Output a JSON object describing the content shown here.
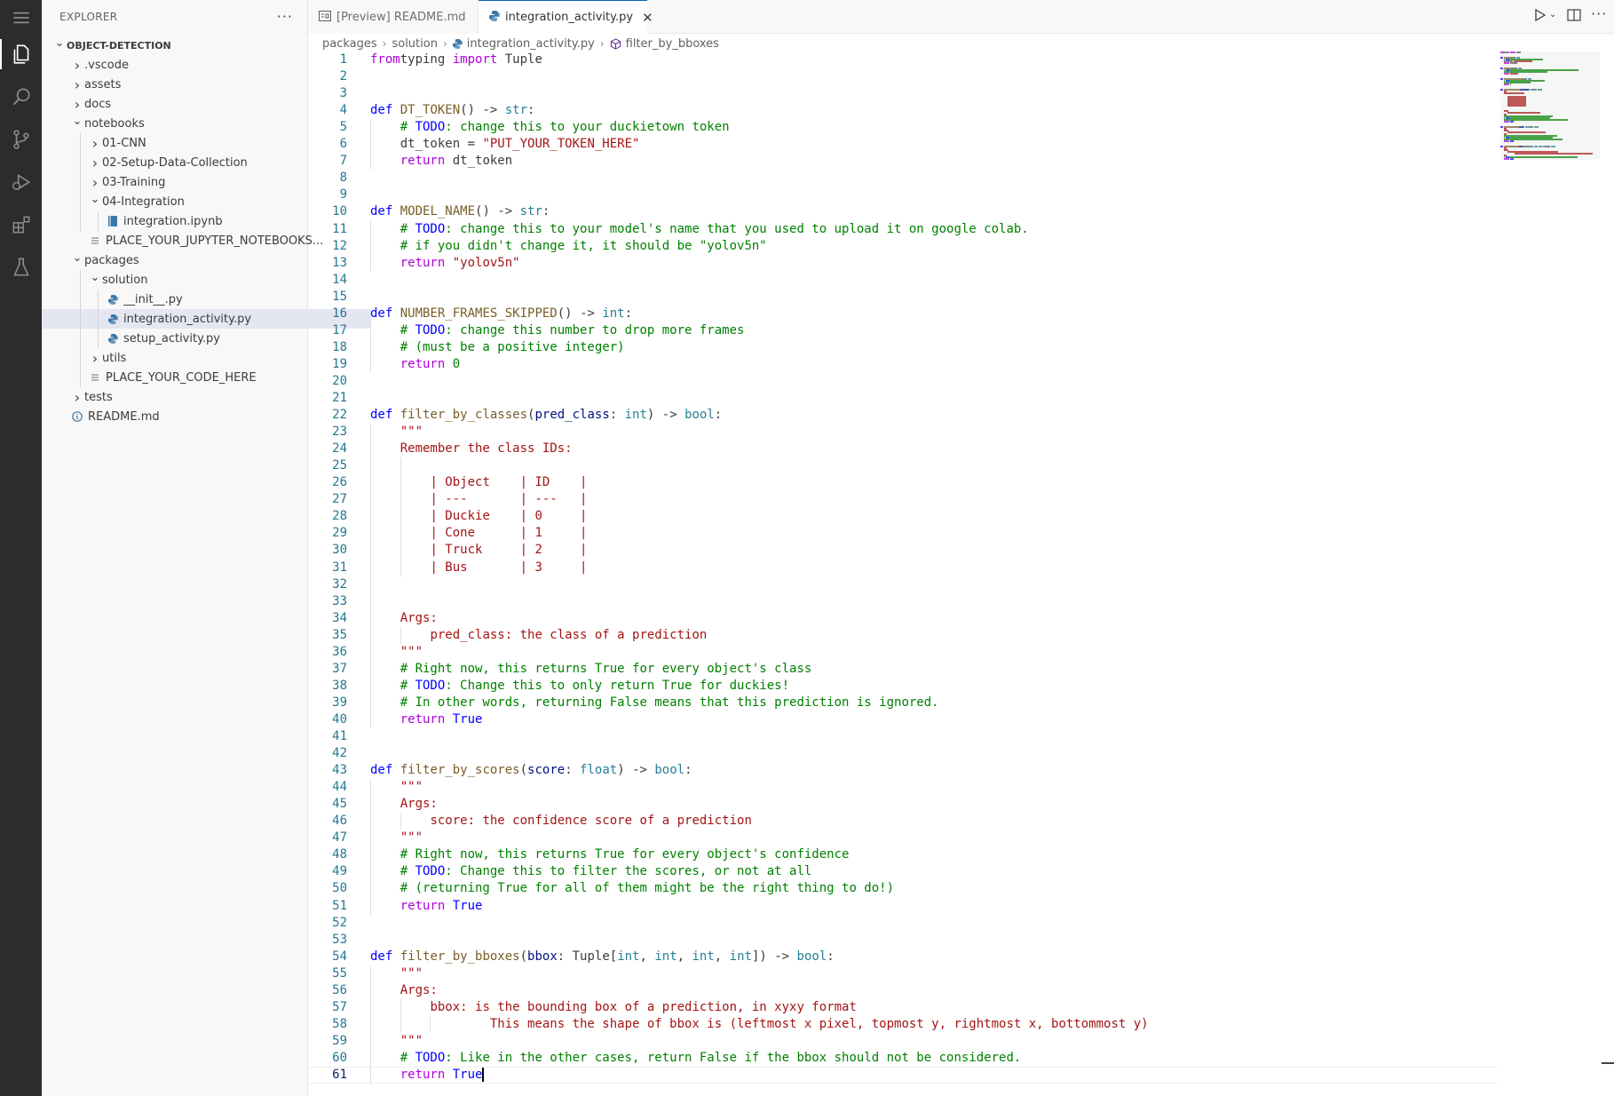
{
  "sidebar": {
    "title": "EXPLORER",
    "more_label": "···",
    "tree": [
      {
        "label": "OBJECT-DETECTION",
        "depth": 0,
        "kind": "root",
        "open": true
      },
      {
        "label": ".vscode",
        "depth": 1,
        "kind": "folder",
        "open": false
      },
      {
        "label": "assets",
        "depth": 1,
        "kind": "folder",
        "open": false
      },
      {
        "label": "docs",
        "depth": 1,
        "kind": "folder",
        "open": false
      },
      {
        "label": "notebooks",
        "depth": 1,
        "kind": "folder",
        "open": true
      },
      {
        "label": "01-CNN",
        "depth": 2,
        "kind": "folder",
        "open": false
      },
      {
        "label": "02-Setup-Data-Collection",
        "depth": 2,
        "kind": "folder",
        "open": false
      },
      {
        "label": "03-Training",
        "depth": 2,
        "kind": "folder",
        "open": false
      },
      {
        "label": "04-Integration",
        "depth": 2,
        "kind": "folder",
        "open": true
      },
      {
        "label": "integration.ipynb",
        "depth": 3,
        "kind": "notebook"
      },
      {
        "label": "PLACE_YOUR_JUPYTER_NOTEBOOKS...",
        "depth": 2,
        "kind": "file"
      },
      {
        "label": "packages",
        "depth": 1,
        "kind": "folder",
        "open": true
      },
      {
        "label": "solution",
        "depth": 2,
        "kind": "folder",
        "open": true
      },
      {
        "label": "__init__.py",
        "depth": 3,
        "kind": "python"
      },
      {
        "label": "integration_activity.py",
        "depth": 3,
        "kind": "python",
        "selected": true
      },
      {
        "label": "setup_activity.py",
        "depth": 3,
        "kind": "python"
      },
      {
        "label": "utils",
        "depth": 2,
        "kind": "folder",
        "open": false
      },
      {
        "label": "PLACE_YOUR_CODE_HERE",
        "depth": 2,
        "kind": "file"
      },
      {
        "label": "tests",
        "depth": 1,
        "kind": "folder",
        "open": false
      },
      {
        "label": "README.md",
        "depth": 1,
        "kind": "info"
      }
    ]
  },
  "tabs": [
    {
      "label": "[Preview] README.md",
      "active": false,
      "icon": "preview-icon"
    },
    {
      "label": "integration_activity.py",
      "active": true,
      "icon": "python-icon"
    }
  ],
  "breadcrumb": [
    "packages",
    "solution",
    "integration_activity.py",
    "filter_by_bboxes"
  ],
  "editor": {
    "current_line": 61,
    "lines": [
      [
        [
          "kc",
          "from"
        ],
        [
          "",
          "typing "
        ],
        [
          "kc",
          "import"
        ],
        [
          "",
          " Tuple"
        ]
      ],
      [],
      [],
      [
        [
          "kw",
          "def"
        ],
        [
          "",
          " "
        ],
        [
          "fn",
          "DT_TOKEN"
        ],
        [
          "",
          "() -> "
        ],
        [
          "ty",
          "str"
        ],
        [
          "",
          ":"
        ]
      ],
      [
        [
          "",
          "    "
        ],
        [
          "cm",
          "# "
        ],
        [
          "td",
          "TODO"
        ],
        [
          "cm",
          ": change this to your duckietown token"
        ]
      ],
      [
        [
          "",
          "    dt_token = "
        ],
        [
          "st",
          "\"PUT_YOUR_TOKEN_HERE\""
        ]
      ],
      [
        [
          "",
          "    "
        ],
        [
          "kc",
          "return"
        ],
        [
          "",
          " dt_token"
        ]
      ],
      [],
      [],
      [
        [
          "kw",
          "def"
        ],
        [
          "",
          " "
        ],
        [
          "fn",
          "MODEL_NAME"
        ],
        [
          "",
          "() -> "
        ],
        [
          "ty",
          "str"
        ],
        [
          "",
          ":"
        ]
      ],
      [
        [
          "",
          "    "
        ],
        [
          "cm",
          "# "
        ],
        [
          "td",
          "TODO"
        ],
        [
          "cm",
          ": change this to your model's name that you used to upload it on google colab."
        ]
      ],
      [
        [
          "",
          "    "
        ],
        [
          "cm",
          "# if you didn't change it, it should be \"yolov5n\""
        ]
      ],
      [
        [
          "",
          "    "
        ],
        [
          "kc",
          "return"
        ],
        [
          "",
          " "
        ],
        [
          "st",
          "\"yolov5n\""
        ]
      ],
      [],
      [],
      [
        [
          "kw",
          "def"
        ],
        [
          "",
          " "
        ],
        [
          "fn",
          "NUMBER_FRAMES_SKIPPED"
        ],
        [
          "",
          "() -> "
        ],
        [
          "ty",
          "int"
        ],
        [
          "",
          ":"
        ]
      ],
      [
        [
          "",
          "    "
        ],
        [
          "cm",
          "# "
        ],
        [
          "td",
          "TODO"
        ],
        [
          "cm",
          ": change this number to drop more frames"
        ]
      ],
      [
        [
          "",
          "    "
        ],
        [
          "cm",
          "# (must be a positive integer)"
        ]
      ],
      [
        [
          "",
          "    "
        ],
        [
          "kc",
          "return"
        ],
        [
          "",
          " "
        ],
        [
          "cm",
          "0"
        ]
      ],
      [],
      [],
      [
        [
          "kw",
          "def"
        ],
        [
          "",
          " "
        ],
        [
          "fn",
          "filter_by_classes"
        ],
        [
          "",
          "("
        ],
        [
          "pm",
          "pred_class"
        ],
        [
          "",
          ": "
        ],
        [
          "ty",
          "int"
        ],
        [
          "",
          ") -> "
        ],
        [
          "ty",
          "bool"
        ],
        [
          "",
          ":"
        ]
      ],
      [
        [
          "",
          "    "
        ],
        [
          "st",
          "\"\"\""
        ]
      ],
      [
        [
          "",
          "    "
        ],
        [
          "st",
          "Remember the class IDs:"
        ]
      ],
      [],
      [
        [
          "",
          "        "
        ],
        [
          "st",
          "| Object    | ID    |"
        ]
      ],
      [
        [
          "",
          "        "
        ],
        [
          "st",
          "| ---       | ---   |"
        ]
      ],
      [
        [
          "",
          "        "
        ],
        [
          "st",
          "| Duckie    | 0     |"
        ]
      ],
      [
        [
          "",
          "        "
        ],
        [
          "st",
          "| Cone      | 1     |"
        ]
      ],
      [
        [
          "",
          "        "
        ],
        [
          "st",
          "| Truck     | 2     |"
        ]
      ],
      [
        [
          "",
          "        "
        ],
        [
          "st",
          "| Bus       | 3     |"
        ]
      ],
      [],
      [],
      [
        [
          "",
          "    "
        ],
        [
          "st",
          "Args:"
        ]
      ],
      [
        [
          "",
          "        "
        ],
        [
          "st",
          "pred_class: the class of a prediction"
        ]
      ],
      [
        [
          "",
          "    "
        ],
        [
          "st",
          "\"\"\""
        ]
      ],
      [
        [
          "",
          "    "
        ],
        [
          "cm",
          "# Right now, this returns True for every object's class"
        ]
      ],
      [
        [
          "",
          "    "
        ],
        [
          "cm",
          "# "
        ],
        [
          "td",
          "TODO"
        ],
        [
          "cm",
          ": Change this to only return True for duckies!"
        ]
      ],
      [
        [
          "",
          "    "
        ],
        [
          "cm",
          "# In other words, returning False means that this prediction is ignored."
        ]
      ],
      [
        [
          "",
          "    "
        ],
        [
          "kc",
          "return"
        ],
        [
          "",
          " "
        ],
        [
          "kw",
          "True"
        ]
      ],
      [],
      [],
      [
        [
          "kw",
          "def"
        ],
        [
          "",
          " "
        ],
        [
          "fn",
          "filter_by_scores"
        ],
        [
          "",
          "("
        ],
        [
          "pm",
          "score"
        ],
        [
          "",
          ": "
        ],
        [
          "ty",
          "float"
        ],
        [
          "",
          ") -> "
        ],
        [
          "ty",
          "bool"
        ],
        [
          "",
          ":"
        ]
      ],
      [
        [
          "",
          "    "
        ],
        [
          "st",
          "\"\"\""
        ]
      ],
      [
        [
          "",
          "    "
        ],
        [
          "st",
          "Args:"
        ]
      ],
      [
        [
          "",
          "        "
        ],
        [
          "st",
          "score: the confidence score of a prediction"
        ]
      ],
      [
        [
          "",
          "    "
        ],
        [
          "st",
          "\"\"\""
        ]
      ],
      [
        [
          "",
          "    "
        ],
        [
          "cm",
          "# Right now, this returns True for every object's confidence"
        ]
      ],
      [
        [
          "",
          "    "
        ],
        [
          "cm",
          "# "
        ],
        [
          "td",
          "TODO"
        ],
        [
          "cm",
          ": Change this to filter the scores, or not at all"
        ]
      ],
      [
        [
          "",
          "    "
        ],
        [
          "cm",
          "# (returning True for all of them might be the right thing to do!)"
        ]
      ],
      [
        [
          "",
          "    "
        ],
        [
          "kc",
          "return"
        ],
        [
          "",
          " "
        ],
        [
          "kw",
          "True"
        ]
      ],
      [],
      [],
      [
        [
          "kw",
          "def"
        ],
        [
          "",
          " "
        ],
        [
          "fn",
          "filter_by_bboxes"
        ],
        [
          "",
          "("
        ],
        [
          "pm",
          "bbox"
        ],
        [
          "",
          ": Tuple["
        ],
        [
          "ty",
          "int"
        ],
        [
          "",
          ", "
        ],
        [
          "ty",
          "int"
        ],
        [
          "",
          ", "
        ],
        [
          "ty",
          "int"
        ],
        [
          "",
          ", "
        ],
        [
          "ty",
          "int"
        ],
        [
          "",
          "]) -> "
        ],
        [
          "ty",
          "bool"
        ],
        [
          "",
          ":"
        ]
      ],
      [
        [
          "",
          "    "
        ],
        [
          "st",
          "\"\"\""
        ]
      ],
      [
        [
          "",
          "    "
        ],
        [
          "st",
          "Args:"
        ]
      ],
      [
        [
          "",
          "        "
        ],
        [
          "st",
          "bbox: is the bounding box of a prediction, in xyxy format"
        ]
      ],
      [
        [
          "",
          "                "
        ],
        [
          "st",
          "This means the shape of bbox is (leftmost x pixel, topmost y, rightmost x, bottommost y)"
        ]
      ],
      [
        [
          "",
          "    "
        ],
        [
          "st",
          "\"\"\""
        ]
      ],
      [
        [
          "",
          "    "
        ],
        [
          "cm",
          "# "
        ],
        [
          "td",
          "TODO"
        ],
        [
          "cm",
          ": Like in the other cases, return False if the bbox should not be considered."
        ]
      ],
      [
        [
          "",
          "    "
        ],
        [
          "kc",
          "return"
        ],
        [
          "",
          " "
        ],
        [
          "kw",
          "True"
        ]
      ]
    ]
  }
}
